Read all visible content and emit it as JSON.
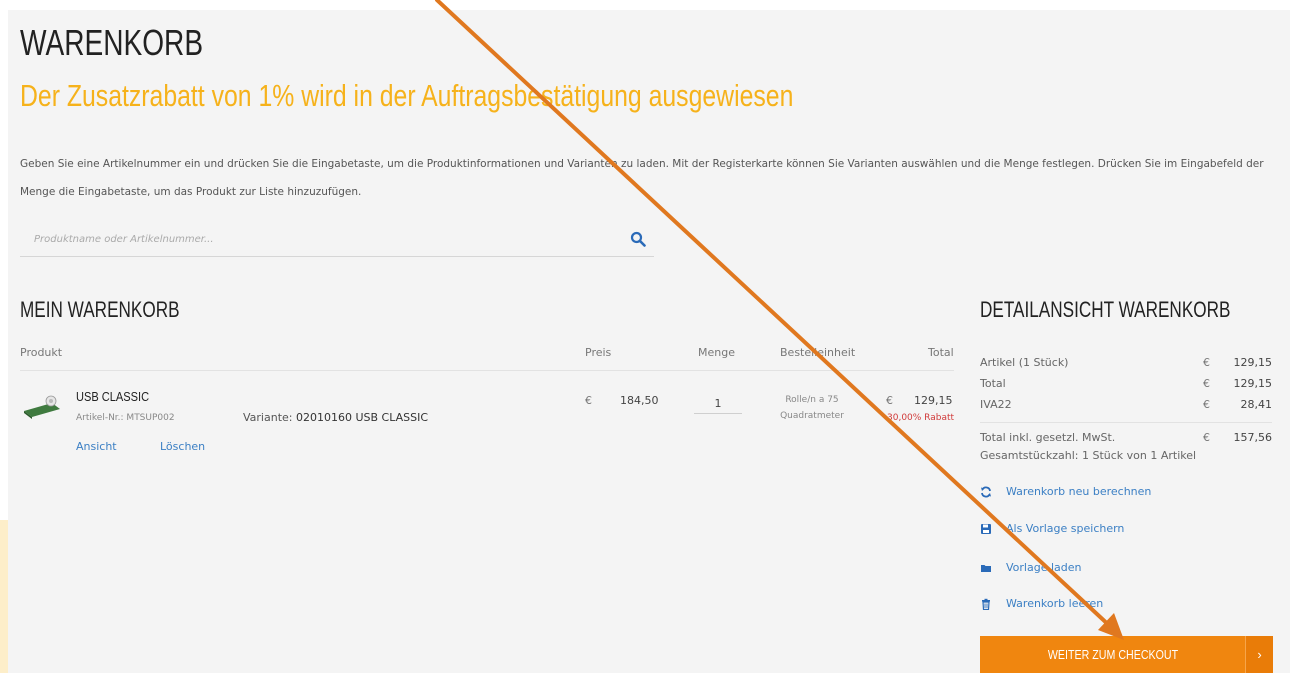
{
  "page": {
    "title": "WARENKORB",
    "promo": "Der Zusatzrabatt von 1% wird in der Auftragsbestätigung ausgewiesen",
    "intro": "Geben Sie eine Artikelnummer ein und drücken Sie die Eingabetaste, um die Produktinformationen und Varianten zu laden. Mit der Registerkarte können Sie Varianten auswählen und die Menge festlegen. Drücken Sie im Eingabefeld der Menge die Eingabetaste, um das Produkt zur Liste hinzuzufügen."
  },
  "search": {
    "placeholder": "Produktname oder Artikelnummer...",
    "icon": "search-icon"
  },
  "cart": {
    "title": "MEIN WARENKORB",
    "columns": {
      "product": "Produkt",
      "price": "Preis",
      "quantity": "Menge",
      "unit": "Bestelleinheit",
      "total": "Total"
    },
    "items": [
      {
        "name": "USB CLASSIC",
        "sku_label": "Artikel-Nr.: MTSUP002",
        "variant_label": "Variante:",
        "variant_value": "02010160 USB CLASSIC",
        "currency": "€",
        "price": "184,50",
        "quantity": "1",
        "unit_line1": "Rolle/n a 75",
        "unit_line2": "Quadratmeter",
        "total": "129,15",
        "discount": "30,00% Rabatt",
        "view_link": "Ansicht",
        "delete_link": "Löschen"
      }
    ]
  },
  "summary": {
    "title": "DETAILANSICHT WARENKORB",
    "rows": [
      {
        "label": "Artikel (1 Stück)",
        "currency": "€",
        "value": "129,15"
      },
      {
        "label": "Total",
        "currency": "€",
        "value": "129,15"
      },
      {
        "label": "IVA22",
        "currency": "€",
        "value": "28,41"
      }
    ],
    "grand_label": "Total inkl. gesetzl. MwSt.",
    "grand_currency": "€",
    "grand_value": "157,56",
    "count_line": "Gesamtstückzahl: 1 Stück von 1 Artikel",
    "actions": [
      {
        "label": "Warenkorb neu berechnen",
        "icon": "refresh-icon"
      },
      {
        "label": "Als Vorlage speichern",
        "icon": "save-icon"
      },
      {
        "label": "Vorlage laden",
        "icon": "folder-icon"
      },
      {
        "label": "Warenkorb leeren",
        "icon": "trash-icon"
      }
    ],
    "checkout_label": "WEITER ZUM CHECKOUT",
    "checkout_arrow": "›"
  },
  "colors": {
    "accent": "#f0860f",
    "promo": "#f6b21b",
    "link": "#3b7fc4",
    "discount": "#d13b3b"
  }
}
